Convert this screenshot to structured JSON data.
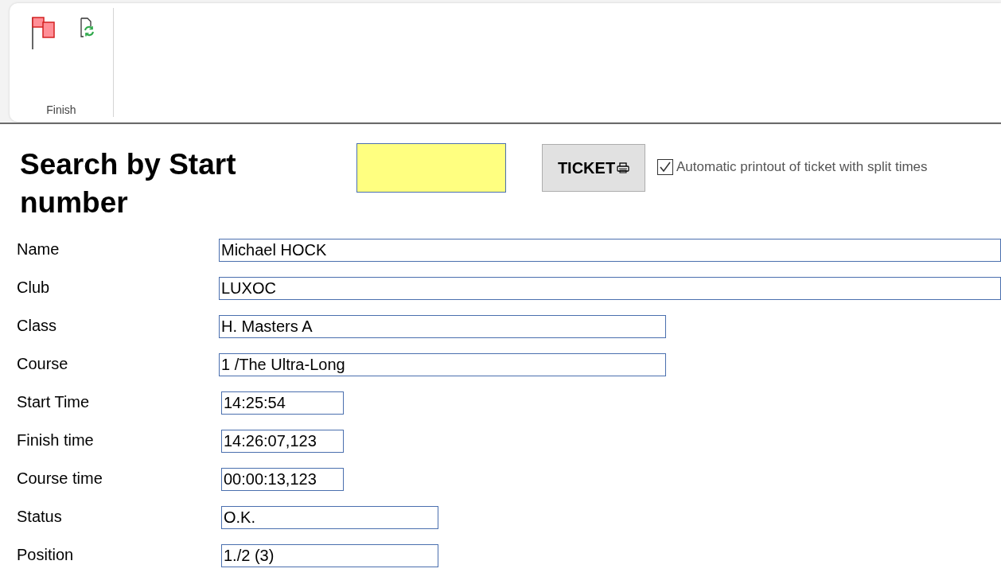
{
  "ribbon": {
    "group_label": "Finish"
  },
  "search": {
    "title": "Search by Start number"
  },
  "ticket_button": {
    "label": "TICKET"
  },
  "auto_print": {
    "label": "Automatic printout of ticket with split times",
    "checked": true
  },
  "fields": [
    {
      "label": "Name",
      "value": "Michael HOCK",
      "kind": "full"
    },
    {
      "label": "Club",
      "value": "LUXOC",
      "kind": "full"
    },
    {
      "label": "Class",
      "value": "H. Masters A",
      "kind": "long"
    },
    {
      "label": "Course",
      "value": "1 /The Ultra-Long",
      "kind": "long"
    },
    {
      "label": "Start Time",
      "value": "14:25:54",
      "kind": "short"
    },
    {
      "label": "Finish time",
      "value": "14:26:07,123",
      "kind": "short"
    },
    {
      "label": "Course time",
      "value": "00:00:13,123",
      "kind": "short"
    },
    {
      "label": "Status",
      "value": "O.K.",
      "kind": "medium"
    },
    {
      "label": "Position",
      "value": "1./2 (3)",
      "kind": "medium"
    }
  ]
}
